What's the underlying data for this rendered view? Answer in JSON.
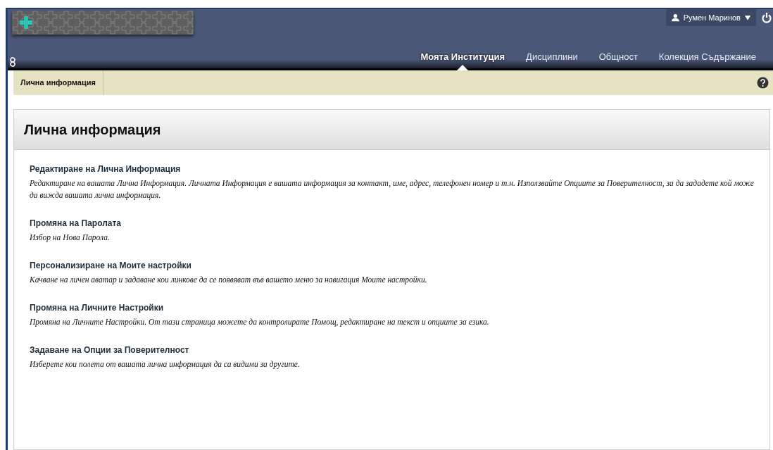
{
  "user_menu": {
    "name": "Румен Маринов"
  },
  "tabs": [
    {
      "label": "Моята Институция",
      "selected": true
    },
    {
      "label": "Дисциплини",
      "selected": false
    },
    {
      "label": "Общност",
      "selected": false
    },
    {
      "label": "Колекция Съдържание",
      "selected": false
    }
  ],
  "breadcrumb": "Лична информация",
  "page_title": "Лична информация",
  "items": [
    {
      "title": "Редактиране на Лична Информация",
      "description": "Редактиране на вашата Лична Информация. Личната Информация е вашата информация за контакт, име, адрес, телефонен номер и т.н. Използвайте Опциите за Поверителност, за да зададете кой може да вижда вашата лична информация."
    },
    {
      "title": "Промяна на Паролата",
      "description": "Избор на Нова Парола."
    },
    {
      "title": "Персонализиране на Моите настройки",
      "description": "Качване на личен аватар и задаване кои линкове да се появяват във вашето меню за навигация Моите настройки."
    },
    {
      "title": "Промяна на Личните Настройки",
      "description": "Промяна на Личните Настройки. От тази страница можете да контролирате Помощ, редактиране на текст и опциите за езика."
    },
    {
      "title": "Задаване на Опции за Поверителност",
      "description": "Изберете кои полета от вашата лична информация да са видими за другите."
    }
  ]
}
